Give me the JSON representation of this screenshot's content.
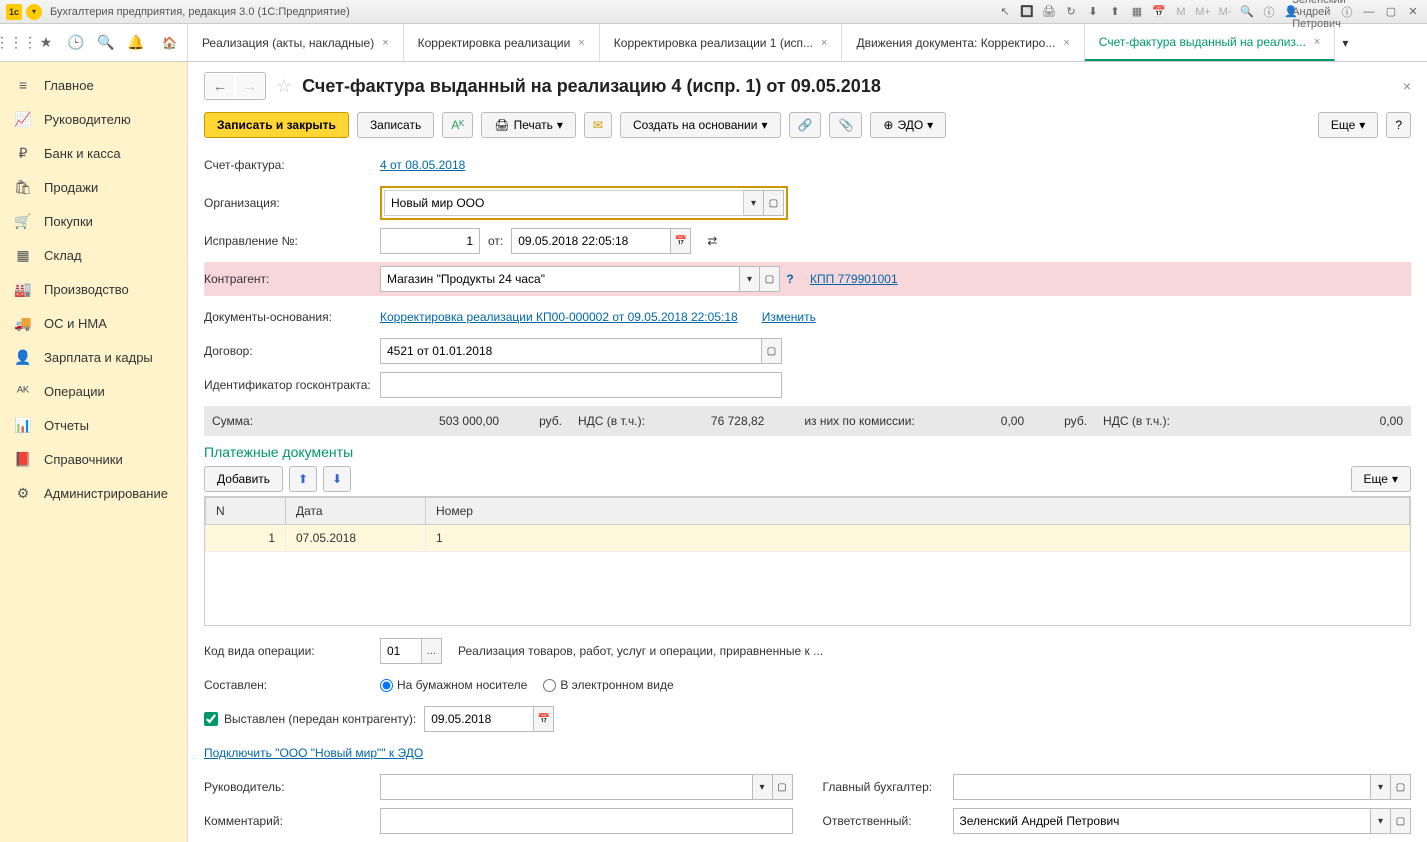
{
  "titlebar": {
    "app_title": "Бухгалтерия предприятия, редакция 3.0  (1С:Предприятие)",
    "user": "Зеленский Андрей Петрович"
  },
  "tabs": {
    "items": [
      {
        "label": "Реализация (акты, накладные)",
        "closable": true
      },
      {
        "label": "Корректировка реализации",
        "closable": true
      },
      {
        "label": "Корректировка реализации 1 (исп...",
        "closable": true
      },
      {
        "label": "Движения документа: Корректиро...",
        "closable": true
      },
      {
        "label": "Счет-фактура выданный на реализ...",
        "closable": true,
        "active": true
      }
    ]
  },
  "sidebar": {
    "items": [
      {
        "icon": "≡",
        "label": "Главное"
      },
      {
        "icon": "📈",
        "label": "Руководителю"
      },
      {
        "icon": "₽",
        "label": "Банк и касса"
      },
      {
        "icon": "🛍",
        "label": "Продажи"
      },
      {
        "icon": "🛒",
        "label": "Покупки"
      },
      {
        "icon": "▦",
        "label": "Склад"
      },
      {
        "icon": "🏭",
        "label": "Производство"
      },
      {
        "icon": "🚚",
        "label": "ОС и НМА"
      },
      {
        "icon": "👤",
        "label": "Зарплата и кадры"
      },
      {
        "icon": "ᴬᴷ",
        "label": "Операции"
      },
      {
        "icon": "📊",
        "label": "Отчеты"
      },
      {
        "icon": "📕",
        "label": "Справочники"
      },
      {
        "icon": "⚙",
        "label": "Администрирование"
      }
    ]
  },
  "page": {
    "title": "Счет-фактура выданный на реализацию 4 (испр. 1) от 09.05.2018",
    "actions": {
      "save_close": "Записать и закрыть",
      "save": "Записать",
      "print": "Печать",
      "create_based": "Создать на основании",
      "edo": "ЭДО",
      "more": "Еще",
      "help": "?"
    },
    "form": {
      "invoice_label": "Счет-фактура:",
      "invoice_link": "4 от 08.05.2018",
      "org_label": "Организация:",
      "org_value": "Новый мир ООО",
      "correction_label": "Исправление №:",
      "correction_num": "1",
      "correction_from": "от:",
      "correction_date": "09.05.2018 22:05:18",
      "counterparty_label": "Контрагент:",
      "counterparty_value": "Магазин \"Продукты 24 часа\"",
      "kpp_link": "КПП 779901001",
      "basis_label": "Документы-основания:",
      "basis_link": "Корректировка реализации КП00-000002 от 09.05.2018 22:05:18",
      "change_link": "Изменить",
      "contract_label": "Договор:",
      "contract_value": "4521 от 01.01.2018",
      "goscontract_label": "Идентификатор госконтракта:",
      "goscontract_value": ""
    },
    "summary": {
      "sum_label": "Сумма:",
      "sum_value": "503 000,00",
      "currency": "руб.",
      "vat_label": "НДС (в т.ч.):",
      "vat_value": "76 728,82",
      "commission_label": "из них по комиссии:",
      "commission_value": "0,00",
      "currency2": "руб.",
      "vat2_label": "НДС (в т.ч.):",
      "vat2_value": "0,00"
    },
    "payment_docs": {
      "title": "Платежные документы",
      "add": "Добавить",
      "more": "Еще",
      "headers": [
        "N",
        "Дата",
        "Номер"
      ],
      "rows": [
        {
          "n": "1",
          "date": "07.05.2018",
          "number": "1"
        }
      ]
    },
    "footer": {
      "op_code_label": "Код вида операции:",
      "op_code_value": "01",
      "op_desc": "Реализация товаров, работ, услуг и операции, приравненные к ...",
      "compiled_label": "Составлен:",
      "paper_label": "На бумажном носителе",
      "electronic_label": "В электронном виде",
      "issued_label": "Выставлен (передан контрагенту):",
      "issued_date": "09.05.2018",
      "edo_link": "Подключить \"ООО \"Новый мир\"\" к ЭДО",
      "manager_label": "Руководитель:",
      "manager_value": "",
      "accountant_label": "Главный бухгалтер:",
      "accountant_value": "",
      "comment_label": "Комментарий:",
      "comment_value": "",
      "responsible_label": "Ответственный:",
      "responsible_value": "Зеленский Андрей Петрович"
    }
  }
}
